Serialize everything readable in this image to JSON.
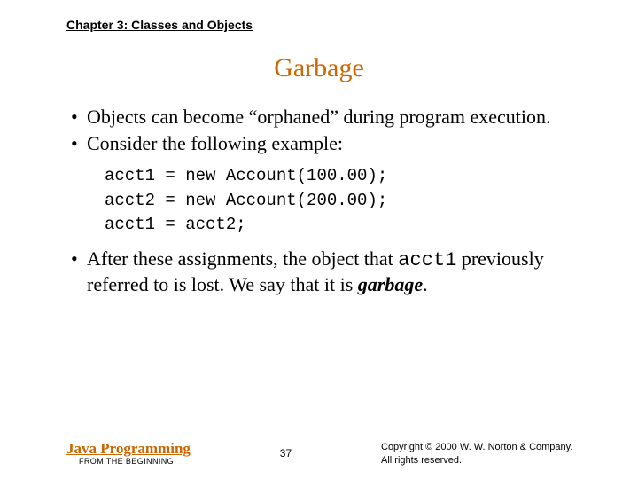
{
  "chapter": "Chapter 3: Classes and Objects",
  "title": "Garbage",
  "bullets": {
    "b1": "Objects can become “orphaned” during program execution.",
    "b2": "Consider the following example:",
    "b3_pre": "After these assignments, the object that ",
    "b3_code": "acct1",
    "b3_mid": " previously referred to is lost. We say that it is ",
    "b3_emph": "garbage",
    "b3_post": "."
  },
  "code": "acct1 = new Account(100.00);\nacct2 = new Account(200.00);\nacct1 = acct2;",
  "footer": {
    "brand_line1": "Java Programming",
    "brand_line2": "FROM THE BEGINNING",
    "page": "37",
    "copyright_l1": "Copyright © 2000 W. W. Norton & Company.",
    "copyright_l2": "All rights reserved."
  }
}
